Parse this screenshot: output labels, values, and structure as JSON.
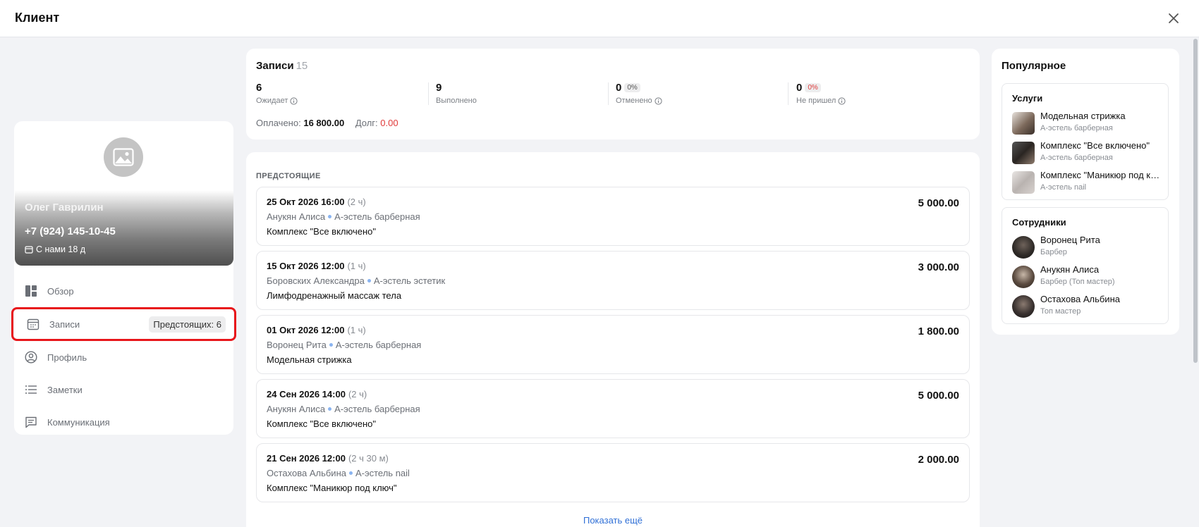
{
  "header": {
    "title": "Клиент"
  },
  "client": {
    "name": "Олег Гаврилин",
    "phone": "+7 (924) 145-10-45",
    "since": "С нами 18 д"
  },
  "nav": {
    "items": [
      {
        "label": "Обзор",
        "icon": "dashboard-icon"
      },
      {
        "label": "Записи",
        "icon": "calendar-icon",
        "badge": "Предстоящих: 6"
      },
      {
        "label": "Профиль",
        "icon": "user-circle-icon"
      },
      {
        "label": "Заметки",
        "icon": "list-icon"
      },
      {
        "label": "Коммуникация",
        "icon": "message-icon"
      }
    ]
  },
  "summary": {
    "title": "Записи",
    "count": "15",
    "stats": [
      {
        "value": "6",
        "label": "Ожидает",
        "pct": ""
      },
      {
        "value": "9",
        "label": "Выполнено",
        "pct": ""
      },
      {
        "value": "0",
        "label": "Отменено",
        "pct": "0%"
      },
      {
        "value": "0",
        "label": "Не пришел",
        "pct": "0%"
      }
    ],
    "paid_label": "Оплачено:",
    "paid_value": "16 800.00",
    "debt_label": "Долг:",
    "debt_value": "0.00"
  },
  "upcoming": {
    "section_title": "ПРЕДСТОЯЩИЕ",
    "items": [
      {
        "when": "25 Окт 2026 16:00",
        "duration": "(2 ч)",
        "staff": "Анукян Алиса",
        "salon": "А-эстель барберная",
        "service": "Комплекс \"Все включено\"",
        "price": "5 000.00"
      },
      {
        "when": "15 Окт 2026 12:00",
        "duration": "(1 ч)",
        "staff": "Боровских Александра",
        "salon": "А-эстель эстетик",
        "service": "Лимфодренажный массаж тела",
        "price": "3 000.00"
      },
      {
        "when": "01 Окт 2026 12:00",
        "duration": "(1 ч)",
        "staff": "Воронец Рита",
        "salon": "А-эстель барберная",
        "service": "Модельная стрижка",
        "price": "1 800.00"
      },
      {
        "when": "24 Сен 2026 14:00",
        "duration": "(2 ч)",
        "staff": "Анукян Алиса",
        "salon": "А-эстель барберная",
        "service": "Комплекс \"Все включено\"",
        "price": "5 000.00"
      },
      {
        "when": "21 Сен 2026 12:00",
        "duration": "(2 ч 30 м)",
        "staff": "Остахова Альбина",
        "salon": "А-эстель nail",
        "service": "Комплекс \"Маникюр под ключ\"",
        "price": "2 000.00"
      }
    ],
    "show_more": "Показать ещё"
  },
  "popular": {
    "title": "Популярное",
    "services_title": "Услуги",
    "services": [
      {
        "name": "Модельная стрижка",
        "sub": "А-эстель барберная"
      },
      {
        "name": "Комплекс \"Все включено\"",
        "sub": "А-эстель барберная"
      },
      {
        "name": "Комплекс \"Маникюр под ключ\"",
        "sub": "А-эстель nail"
      }
    ],
    "staff_title": "Сотрудники",
    "staff": [
      {
        "name": "Воронец Рита",
        "sub": "Барбер"
      },
      {
        "name": "Анукян Алиса",
        "sub": "Барбер (Топ мастер)"
      },
      {
        "name": "Остахова Альбина",
        "sub": "Топ мастер"
      }
    ]
  },
  "colors": {
    "active_outline": "#e8161b",
    "link": "#2f6fd6",
    "negative": "#e03a3a"
  }
}
